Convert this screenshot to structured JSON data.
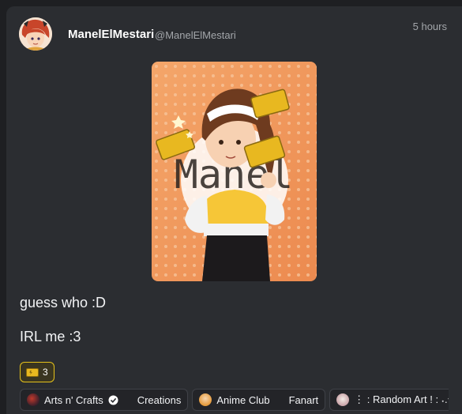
{
  "post": {
    "author_name": "ManelElMestari",
    "author_handle": "@ManelElMestari",
    "timestamp": "5 hours",
    "image_watermark": "Manel",
    "text_lines": [
      "guess who :D",
      "IRL me :3"
    ]
  },
  "reaction": {
    "icon": "golden-ticket-icon",
    "count": "3"
  },
  "communities": [
    {
      "name": "Arts n' Crafts",
      "verified": true,
      "channel": "Creations",
      "icon": "community-arts-icon"
    },
    {
      "name": "Anime Club",
      "verified": false,
      "channel": "Fanart",
      "icon": "community-anime-icon"
    },
    {
      "name": "⋮ : Random Art ! : ˖.ᐟ",
      "verified": false,
      "channel": "",
      "icon": "community-random-art-icon"
    }
  ],
  "colors": {
    "background": "#1e1f22",
    "card": "#2b2d31",
    "reaction_border": "#e5c21b",
    "muted_text": "#a3a6aa"
  }
}
